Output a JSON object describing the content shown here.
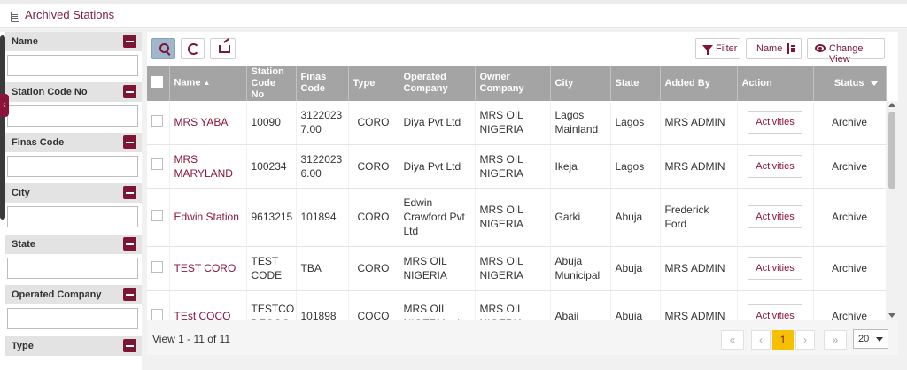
{
  "page": {
    "title": "Archived Stations"
  },
  "filters": [
    {
      "label": "Name",
      "value": ""
    },
    {
      "label": "Station Code No",
      "value": ""
    },
    {
      "label": "Finas Code",
      "value": ""
    },
    {
      "label": "City",
      "value": ""
    },
    {
      "label": "State",
      "value": ""
    },
    {
      "label": "Operated Company",
      "value": ""
    },
    {
      "label": "Type",
      "value": ""
    }
  ],
  "toolbar": {
    "filter_label": "Filter",
    "name_label": "Name",
    "change_view_label": "Change View",
    "icons": [
      "search-icon",
      "refresh-icon",
      "export-icon",
      "funnel-icon",
      "sort-icon",
      "eye-icon"
    ]
  },
  "table": {
    "headers": {
      "name": "Name",
      "station_code": "Station Code No",
      "finas_code": "Finas Code",
      "type": "Type",
      "operated_company": "Operated Company",
      "owner_company": "Owner Company",
      "city": "City",
      "state": "State",
      "added_by": "Added By",
      "action": "Action",
      "status": "Status"
    },
    "rows": [
      {
        "name": "MRS YABA",
        "station_code": "10090",
        "finas_code": "3122023 7.00",
        "type": "CORO",
        "operated_company": "Diya Pvt Ltd",
        "owner_company": "MRS OIL NIGERIA",
        "city": "Lagos Mainland",
        "state": "Lagos",
        "added_by": "MRS ADMIN",
        "action": "Activities",
        "status": "Archive"
      },
      {
        "name": "MRS MARYLAND",
        "station_code": "100234",
        "finas_code": "3122023 6.00",
        "type": "CORO",
        "operated_company": "Diya Pvt Ltd",
        "owner_company": "MRS OIL NIGERIA",
        "city": "Ikeja",
        "state": "Lagos",
        "added_by": "MRS ADMIN",
        "action": "Activities",
        "status": "Archive"
      },
      {
        "name": "Edwin Station",
        "station_code": "9613215",
        "finas_code": "101894",
        "type": "CORO",
        "operated_company": "Edwin Crawford Pvt Ltd",
        "owner_company": "MRS OIL NIGERIA",
        "city": "Garki",
        "state": "Abuja",
        "added_by": "Frederick Ford",
        "action": "Activities",
        "status": "Archive"
      },
      {
        "name": "TEST CORO",
        "station_code": "TEST CODE",
        "finas_code": "TBA",
        "type": "CORO",
        "operated_company": "MRS OIL NIGERIA",
        "owner_company": "MRS OIL NIGERIA",
        "city": "Abuja Municipal",
        "state": "Abuja",
        "added_by": "MRS ADMIN",
        "action": "Activities",
        "status": "Archive"
      },
      {
        "name": "TEst COCO",
        "station_code": "TESTCO DECOC",
        "finas_code": "101898",
        "type": "COCO",
        "operated_company": "MRS OIL NIGERIA - /",
        "owner_company": "MRS OIL NIGERIA",
        "city": "Abaji",
        "state": "Abuja",
        "added_by": "MRS ADMIN",
        "action": "Activities",
        "status": "Archive"
      }
    ]
  },
  "footer": {
    "info": "View 1 - 11 of 11",
    "current_page": "1",
    "page_size": "20"
  },
  "colors": {
    "brand": "#7d1535",
    "header_bg": "#a4a4a4",
    "current_page": "#f5c000"
  }
}
